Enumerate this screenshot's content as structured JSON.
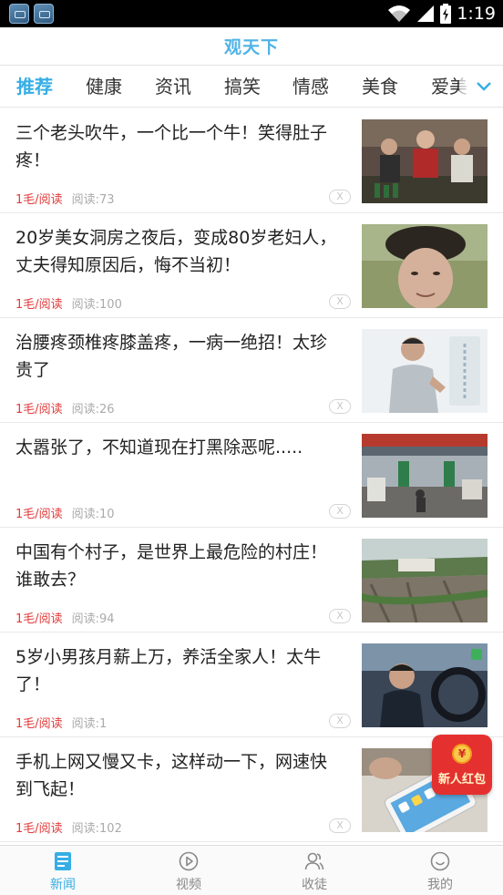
{
  "status_bar": {
    "time": "1:19",
    "app_icons": [
      "app-notification-icon",
      "app-notification-icon"
    ],
    "indicators": [
      "wifi-icon",
      "signal-icon",
      "battery-icon"
    ]
  },
  "header": {
    "title": "观天下"
  },
  "tabs": [
    {
      "label": "推荐",
      "active": true
    },
    {
      "label": "健康",
      "active": false
    },
    {
      "label": "资讯",
      "active": false
    },
    {
      "label": "搞笑",
      "active": false
    },
    {
      "label": "情感",
      "active": false
    },
    {
      "label": "美食",
      "active": false
    },
    {
      "label": "爱美",
      "active": false
    }
  ],
  "feed": {
    "items": [
      {
        "title": "三个老头吹牛，一个比一个牛！笑得肚子疼！",
        "reward": "1毛/阅读",
        "reads": "阅读:73",
        "close": "X",
        "thumb": "old-men-drinking-photo"
      },
      {
        "title": "20岁美女洞房之夜后，变成80岁老妇人，丈夫得知原因后，悔不当初！",
        "reward": "1毛/阅读",
        "reads": "阅读:100",
        "close": "X",
        "thumb": "elderly-woman-photo"
      },
      {
        "title": "治腰疼颈椎疼膝盖疼，一病一绝招！太珍贵了",
        "reward": "1毛/阅读",
        "reads": "阅读:26",
        "close": "X",
        "thumb": "back-pain-photo"
      },
      {
        "title": "太嚣张了，不知道现在打黑除恶呢.....",
        "reward": "1毛/阅读",
        "reads": "阅读:10",
        "close": "X",
        "thumb": "toll-station-photo"
      },
      {
        "title": "中国有个村子，是世界上最危险的村庄！谁敢去？",
        "reward": "1毛/阅读",
        "reads": "阅读:94",
        "close": "X",
        "thumb": "cliff-village-photo"
      },
      {
        "title": "5岁小男孩月薪上万，养活全家人！太牛了！",
        "reward": "1毛/阅读",
        "reads": "阅读:1",
        "close": "X",
        "thumb": "boy-driving-photo"
      },
      {
        "title": "手机上网又慢又卡，这样动一下，网速快到飞起！",
        "reward": "1毛/阅读",
        "reads": "阅读:102",
        "close": "X",
        "thumb": "smartphone-photo"
      }
    ]
  },
  "red_packet": {
    "label": "新人红包",
    "coin_symbol": "¥"
  },
  "bottom_nav": [
    {
      "label": "新闻",
      "icon": "news-icon",
      "active": true
    },
    {
      "label": "视频",
      "icon": "play-icon",
      "active": false
    },
    {
      "label": "收徒",
      "icon": "people-icon",
      "active": false
    },
    {
      "label": "我的",
      "icon": "smile-icon",
      "active": false
    }
  ],
  "colors": {
    "accent": "#35aee5",
    "title_blue": "#4fb3e6",
    "reward_red": "#e23b3b",
    "red_packet": "#e4312f"
  }
}
